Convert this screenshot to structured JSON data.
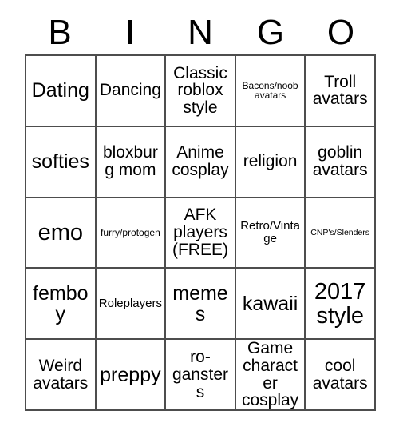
{
  "card": {
    "header": {
      "letters": [
        "B",
        "I",
        "N",
        "G",
        "O"
      ]
    },
    "grid": {
      "columns": 5,
      "rows": 5,
      "border_color": "#4d4d4d",
      "cell_background": "#ffffff",
      "text_color": "#000000",
      "cells": [
        [
          {
            "text": "Dating",
            "size": "lg"
          },
          {
            "text": "Dancing",
            "size": "md"
          },
          {
            "text": "Classic roblox style",
            "size": "md"
          },
          {
            "text": "Bacons/noob avatars",
            "size": "xs"
          },
          {
            "text": "Troll avatars",
            "size": "md"
          }
        ],
        [
          {
            "text": "softies",
            "size": "lg"
          },
          {
            "text": "bloxburg mom",
            "size": "md"
          },
          {
            "text": "Anime cosplay",
            "size": "md"
          },
          {
            "text": "religion",
            "size": "md"
          },
          {
            "text": "goblin avatars",
            "size": "md"
          }
        ],
        [
          {
            "text": "emo",
            "size": "xl"
          },
          {
            "text": "furry/protogen",
            "size": "xs"
          },
          {
            "text": "AFK players (FREE)",
            "size": "md"
          },
          {
            "text": "Retro/Vintage",
            "size": "sm"
          },
          {
            "text": "CNP's/Slenders",
            "size": "xxs"
          }
        ],
        [
          {
            "text": "femboy",
            "size": "lg"
          },
          {
            "text": "Roleplayers",
            "size": "sm"
          },
          {
            "text": "memes",
            "size": "lg"
          },
          {
            "text": "kawaii",
            "size": "lg"
          },
          {
            "text": "2017 style",
            "size": "xl"
          }
        ],
        [
          {
            "text": "Weird avatars",
            "size": "md"
          },
          {
            "text": "preppy",
            "size": "lg"
          },
          {
            "text": "ro-gansters",
            "size": "md"
          },
          {
            "text": "Game character cosplay",
            "size": "md"
          },
          {
            "text": "cool avatars",
            "size": "md"
          }
        ]
      ]
    }
  }
}
